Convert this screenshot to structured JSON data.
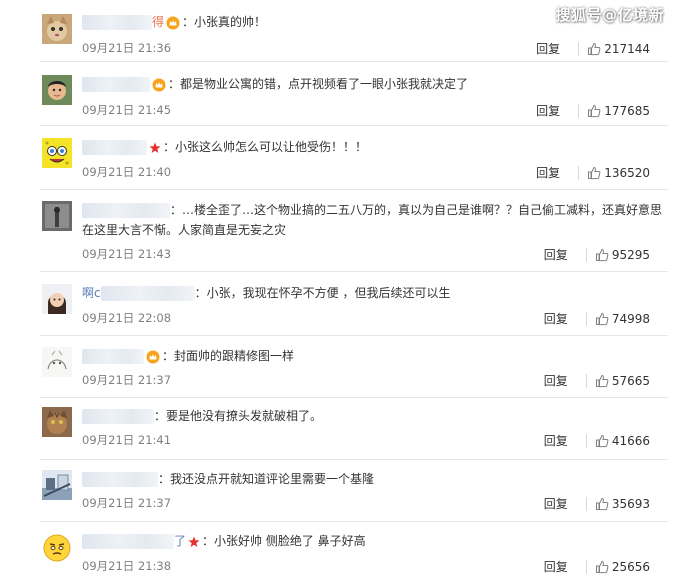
{
  "watermark": "搜狐号@亿境新",
  "comments": [
    {
      "name_fragment": "得",
      "badge": "crown",
      "text": "小张真的帅！",
      "time": "09月21日 21:36",
      "reply": "回复",
      "likes": "217144",
      "avatar": "cat-icon"
    },
    {
      "name_fragment": "",
      "badge": "crown",
      "text": "都是物业公寓的错，点开视频看了一眼小张我就决定了",
      "time": "09月21日 21:45",
      "reply": "回复",
      "likes": "177685",
      "avatar": "man-icon"
    },
    {
      "name_fragment": "",
      "badge": "star",
      "text": "小张这么帅怎么可以让他受伤！！！",
      "time": "09月21日 21:40",
      "reply": "回复",
      "likes": "136520",
      "avatar": "sponge-icon"
    },
    {
      "name_fragment": "",
      "badge": "",
      "text": "…楼全歪了…这个物业搞的二五八万的，真以为自己是谁啊？？自己偷工减料，还真好意思在这里大言不惭。人家简直是无妄之灾",
      "time": "09月21日 21:43",
      "reply": "回复",
      "likes": "95295",
      "avatar": "gray-icon"
    },
    {
      "name_fragment": "啊c",
      "badge": "",
      "text": "小张，我现在怀孕不方便 ，但我后续还可以生",
      "time": "09月21日 22:08",
      "reply": "回复",
      "likes": "74998",
      "avatar": "girl-icon"
    },
    {
      "name_fragment": "",
      "badge": "crown",
      "text": "封面帅的跟精修图一样",
      "time": "09月21日 21:37",
      "reply": "回复",
      "likes": "57665",
      "avatar": "sketch-icon"
    },
    {
      "name_fragment": "",
      "badge": "",
      "text": "要是他没有撩头发就破相了。",
      "time": "09月21日 21:41",
      "reply": "回复",
      "likes": "41666",
      "avatar": "tabby-icon"
    },
    {
      "name_fragment": "",
      "badge": "",
      "text": "我还没点开就知道评论里需要一个基隆",
      "time": "09月21日 21:37",
      "reply": "回复",
      "likes": "35693",
      "avatar": "scene-icon"
    },
    {
      "name_fragment": "了",
      "badge": "star",
      "text": "小张好帅 侧脸绝了 鼻子好高",
      "time": "09月21日 21:38",
      "reply": "回复",
      "likes": "25656",
      "avatar": "emoji-icon"
    }
  ],
  "colors": {
    "name": "#eb7350",
    "time": "#808080",
    "divider": "#e6e6e6",
    "crown": "#f7a31c",
    "star": "#e8312f"
  }
}
